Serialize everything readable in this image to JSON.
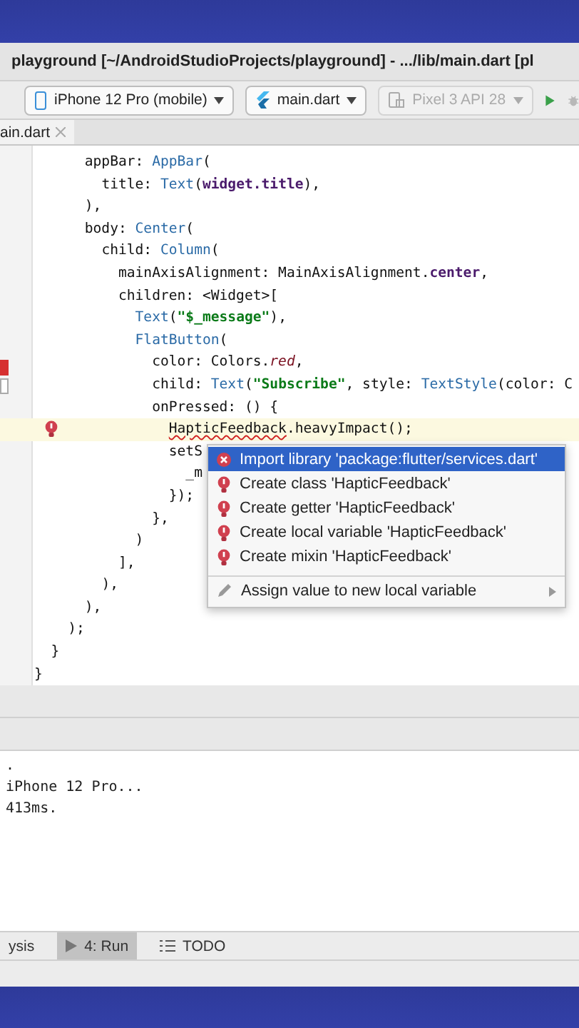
{
  "window": {
    "title": "playground [~/AndroidStudioProjects/playground] - .../lib/main.dart [pl"
  },
  "toolbar": {
    "device": "iPhone 12 Pro (mobile)",
    "config": "main.dart",
    "emulator": {
      "label": "Pixel 3 API 28",
      "disabled": true
    }
  },
  "tabs": [
    {
      "label": "ain.dart",
      "selected": true
    }
  ],
  "editor": {
    "lines": [
      {
        "segments": [
          {
            "kind": "p",
            "text": "      appBar: "
          },
          {
            "kind": "t",
            "text": "AppBar"
          },
          {
            "kind": "p",
            "text": "("
          }
        ]
      },
      {
        "segments": [
          {
            "kind": "p",
            "text": "        title: "
          },
          {
            "kind": "t",
            "text": "Text"
          },
          {
            "kind": "p",
            "text": "("
          },
          {
            "kind": "b",
            "text": "widget.title"
          },
          {
            "kind": "p",
            "text": "),"
          }
        ]
      },
      {
        "segments": [
          {
            "kind": "p",
            "text": "      ),"
          }
        ]
      },
      {
        "segments": [
          {
            "kind": "p",
            "text": "      body: "
          },
          {
            "kind": "t",
            "text": "Center"
          },
          {
            "kind": "p",
            "text": "("
          }
        ]
      },
      {
        "segments": [
          {
            "kind": "p",
            "text": "        child: "
          },
          {
            "kind": "t",
            "text": "Column"
          },
          {
            "kind": "p",
            "text": "("
          }
        ]
      },
      {
        "segments": [
          {
            "kind": "p",
            "text": "          mainAxisAlignment: MainAxisAlignment."
          },
          {
            "kind": "b",
            "text": "center"
          },
          {
            "kind": "p",
            "text": ","
          }
        ]
      },
      {
        "segments": [
          {
            "kind": "p",
            "text": "          children: <Widget>["
          }
        ]
      },
      {
        "segments": [
          {
            "kind": "t",
            "text": "            Text"
          },
          {
            "kind": "p",
            "text": "("
          },
          {
            "kind": "s",
            "text": "\"$_message\""
          },
          {
            "kind": "p",
            "text": "),"
          }
        ]
      },
      {
        "segments": [
          {
            "kind": "t",
            "text": "            FlatButton"
          },
          {
            "kind": "p",
            "text": "("
          }
        ]
      },
      {
        "segments": [
          {
            "kind": "p",
            "text": "              color: Colors."
          },
          {
            "kind": "i",
            "text": "red"
          },
          {
            "kind": "p",
            "text": ","
          }
        ]
      },
      {
        "segments": [
          {
            "kind": "p",
            "text": "              child: "
          },
          {
            "kind": "t",
            "text": "Text"
          },
          {
            "kind": "p",
            "text": "("
          },
          {
            "kind": "s",
            "text": "\"Subscribe\""
          },
          {
            "kind": "p",
            "text": ", style: "
          },
          {
            "kind": "t",
            "text": "TextStyle"
          },
          {
            "kind": "p",
            "text": "(color: C"
          }
        ]
      },
      {
        "segments": [
          {
            "kind": "p",
            "text": "              onPressed: () {"
          }
        ]
      },
      {
        "error": true,
        "segments": [
          {
            "kind": "e",
            "text": "                HapticFeedback"
          },
          {
            "kind": "p",
            "text": ".heavyImpact();"
          }
        ]
      },
      {
        "segments": [
          {
            "kind": "p",
            "text": "                setS"
          }
        ]
      },
      {
        "segments": [
          {
            "kind": "p",
            "text": "                  _m"
          }
        ]
      },
      {
        "segments": [
          {
            "kind": "p",
            "text": "                });"
          }
        ]
      },
      {
        "segments": [
          {
            "kind": "p",
            "text": "              },"
          }
        ]
      },
      {
        "segments": [
          {
            "kind": "p",
            "text": "            )"
          }
        ]
      },
      {
        "segments": [
          {
            "kind": "p",
            "text": "          ],"
          }
        ]
      },
      {
        "segments": [
          {
            "kind": "p",
            "text": "        ),"
          }
        ]
      },
      {
        "segments": [
          {
            "kind": "p",
            "text": "      ),"
          }
        ]
      },
      {
        "segments": [
          {
            "kind": "p",
            "text": "    );"
          }
        ]
      },
      {
        "segments": [
          {
            "kind": "p",
            "text": "  }"
          }
        ]
      },
      {
        "segments": [
          {
            "kind": "p",
            "text": "}"
          }
        ]
      }
    ]
  },
  "popup": {
    "items": [
      {
        "kind": "import",
        "label": "Import library 'package:flutter/services.dart'",
        "selected": true
      },
      {
        "kind": "create",
        "label": "Create class 'HapticFeedback'",
        "selected": false
      },
      {
        "kind": "create",
        "label": "Create getter 'HapticFeedback'",
        "selected": false
      },
      {
        "kind": "create",
        "label": "Create local variable 'HapticFeedback'",
        "selected": false
      },
      {
        "kind": "create",
        "label": "Create mixin 'HapticFeedback'",
        "selected": false
      },
      {
        "kind": "assign",
        "label": "Assign value to new local variable",
        "selected": false
      }
    ]
  },
  "console": {
    "lines": [
      ".",
      "iPhone 12 Pro...",
      "413ms."
    ]
  },
  "tool_tabs": [
    {
      "label": "ysis",
      "kind": "plain",
      "selected": false
    },
    {
      "label": "4: Run",
      "kind": "run",
      "selected": true
    },
    {
      "label": "TODO",
      "kind": "todo",
      "selected": false
    }
  ]
}
